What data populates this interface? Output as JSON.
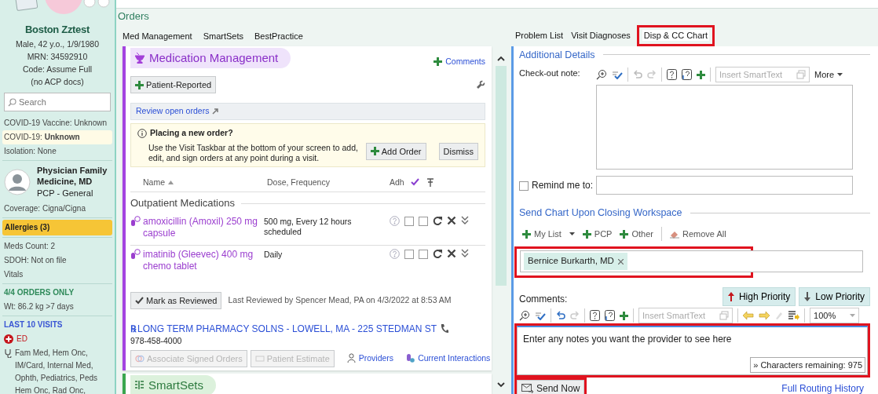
{
  "sidebar": {
    "patient_name": "Boston Zztest",
    "details": [
      "Male, 42 y.o., 1/9/1980",
      "MRN: 34592910",
      "Code: Assume Full",
      "(no ACP docs)"
    ],
    "search": {
      "placeholder": "Search"
    },
    "groups": [
      [
        {
          "kind": "text",
          "text": "COVID-19 Vaccine: Unknown"
        },
        {
          "kind": "notice",
          "text": "COVID-19: **Unknown**"
        },
        {
          "kind": "text",
          "text": "Isolation: None"
        }
      ],
      [
        {
          "kind": "provider",
          "name": "Physician Family Medicine, MD",
          "role": "PCP - General"
        },
        {
          "kind": "text",
          "text": "Coverage: Cigna/Cigna"
        }
      ],
      [
        {
          "kind": "allergy",
          "text": "Allergies (3)"
        }
      ],
      [
        {
          "kind": "text",
          "text": "Meds Count: 2"
        },
        {
          "kind": "text",
          "text": "SDOH: Not on file"
        },
        {
          "kind": "text",
          "text": "Vitals"
        }
      ],
      [
        {
          "kind": "heading",
          "text": "4/4 ORDERS ONLY",
          "color": "#2f8a5a"
        },
        {
          "kind": "text",
          "text": "Wt:  86.2 kg >7 days"
        }
      ],
      [
        {
          "kind": "heading",
          "text": "LAST 10 VISITS",
          "color": "#3a56d4"
        },
        {
          "kind": "ed",
          "text": "ED"
        },
        {
          "kind": "visit",
          "text": "Fam Med, Hem Onc, IM/Card, Internal Med, Ophth, Pediatrics, Peds Hem Onc, Rad Onc,"
        }
      ]
    ]
  },
  "orders": {
    "title": "Orders",
    "tabs": [
      "Med Management",
      "SmartSets",
      "BestPractice"
    ],
    "med_management": {
      "title": "Medication Management",
      "comments_link": "Comments",
      "patient_reported_button": "Patient-Reported",
      "review_link": "Review open orders",
      "notice": {
        "title": "Placing a new order?",
        "text": "Use the Visit Taskbar at the bottom of your screen to add, edit, and sign orders at any point during a visit.",
        "buttons": [
          "Add Order",
          "Dismiss"
        ]
      },
      "columns": [
        "Name",
        "Dose, Frequency",
        "Adh"
      ],
      "group": "Outpatient Medications",
      "medications": [
        {
          "name": "amoxicillin (Amoxil) 250 mg capsule",
          "dose": "500 mg, Every 12 hours scheduled",
          "reviewed": false,
          "pinned": false
        },
        {
          "name": "imatinib (Gleevec) 400 mg chemo tablet",
          "dose": "Daily",
          "reviewed": false,
          "pinned": false
        }
      ],
      "mark_reviewed_button": "Mark as Reviewed",
      "last_reviewed": "Last Reviewed by Spencer Mead, PA on 4/3/2022 at 8:53 AM",
      "pharmacy": {
        "rx_symbol": "℞",
        "name": "LONG TERM PHARMACY SOLNS - LOWELL, MA - 225 STEDMAN ST",
        "phone": "978-458-4000"
      },
      "actions": [
        {
          "kind": "button",
          "label": "Associate Signed Orders",
          "disabled": true
        },
        {
          "kind": "button",
          "label": "Patient Estimate",
          "disabled": true
        },
        {
          "kind": "link",
          "label": "Providers"
        },
        {
          "kind": "link",
          "label": "Current Interactions"
        }
      ]
    },
    "smartsets": {
      "title": "SmartSets"
    }
  },
  "disposition": {
    "tabs": [
      {
        "label": "Problem List",
        "selected": false,
        "highlighted": false
      },
      {
        "label": "Visit Diagnoses",
        "selected": false,
        "highlighted": false
      },
      {
        "label": "Disp & CC Chart",
        "selected": true,
        "highlighted": true
      }
    ],
    "additional_details": {
      "title": "Additional Details",
      "checkout_label": "Check-out note:",
      "smarttext_placeholder": "Insert SmartText",
      "more_menu": "More",
      "remind": {
        "label": "Remind me to:",
        "checked": false
      }
    },
    "send_chart": {
      "title": "Send Chart Upon Closing Workspace",
      "add_buttons": [
        "My List",
        "PCP",
        "Other"
      ],
      "remove_all": "Remove All",
      "recipients": [
        {
          "name": "Bernice Burkarth, MD"
        }
      ],
      "recipients_highlighted": true,
      "comments_label": "Comments:",
      "priority_buttons": [
        "High Priority",
        "Low Priority"
      ],
      "smarttext_placeholder": "Insert SmartText",
      "zoom": "100%",
      "comment": "Enter any notes you want the provider to see here",
      "comment_highlighted": true,
      "characters_remaining": "» Characters remaining: 975",
      "send_button": {
        "label": "Send Now",
        "highlighted": true
      },
      "history_link": "Full Routing History"
    }
  }
}
